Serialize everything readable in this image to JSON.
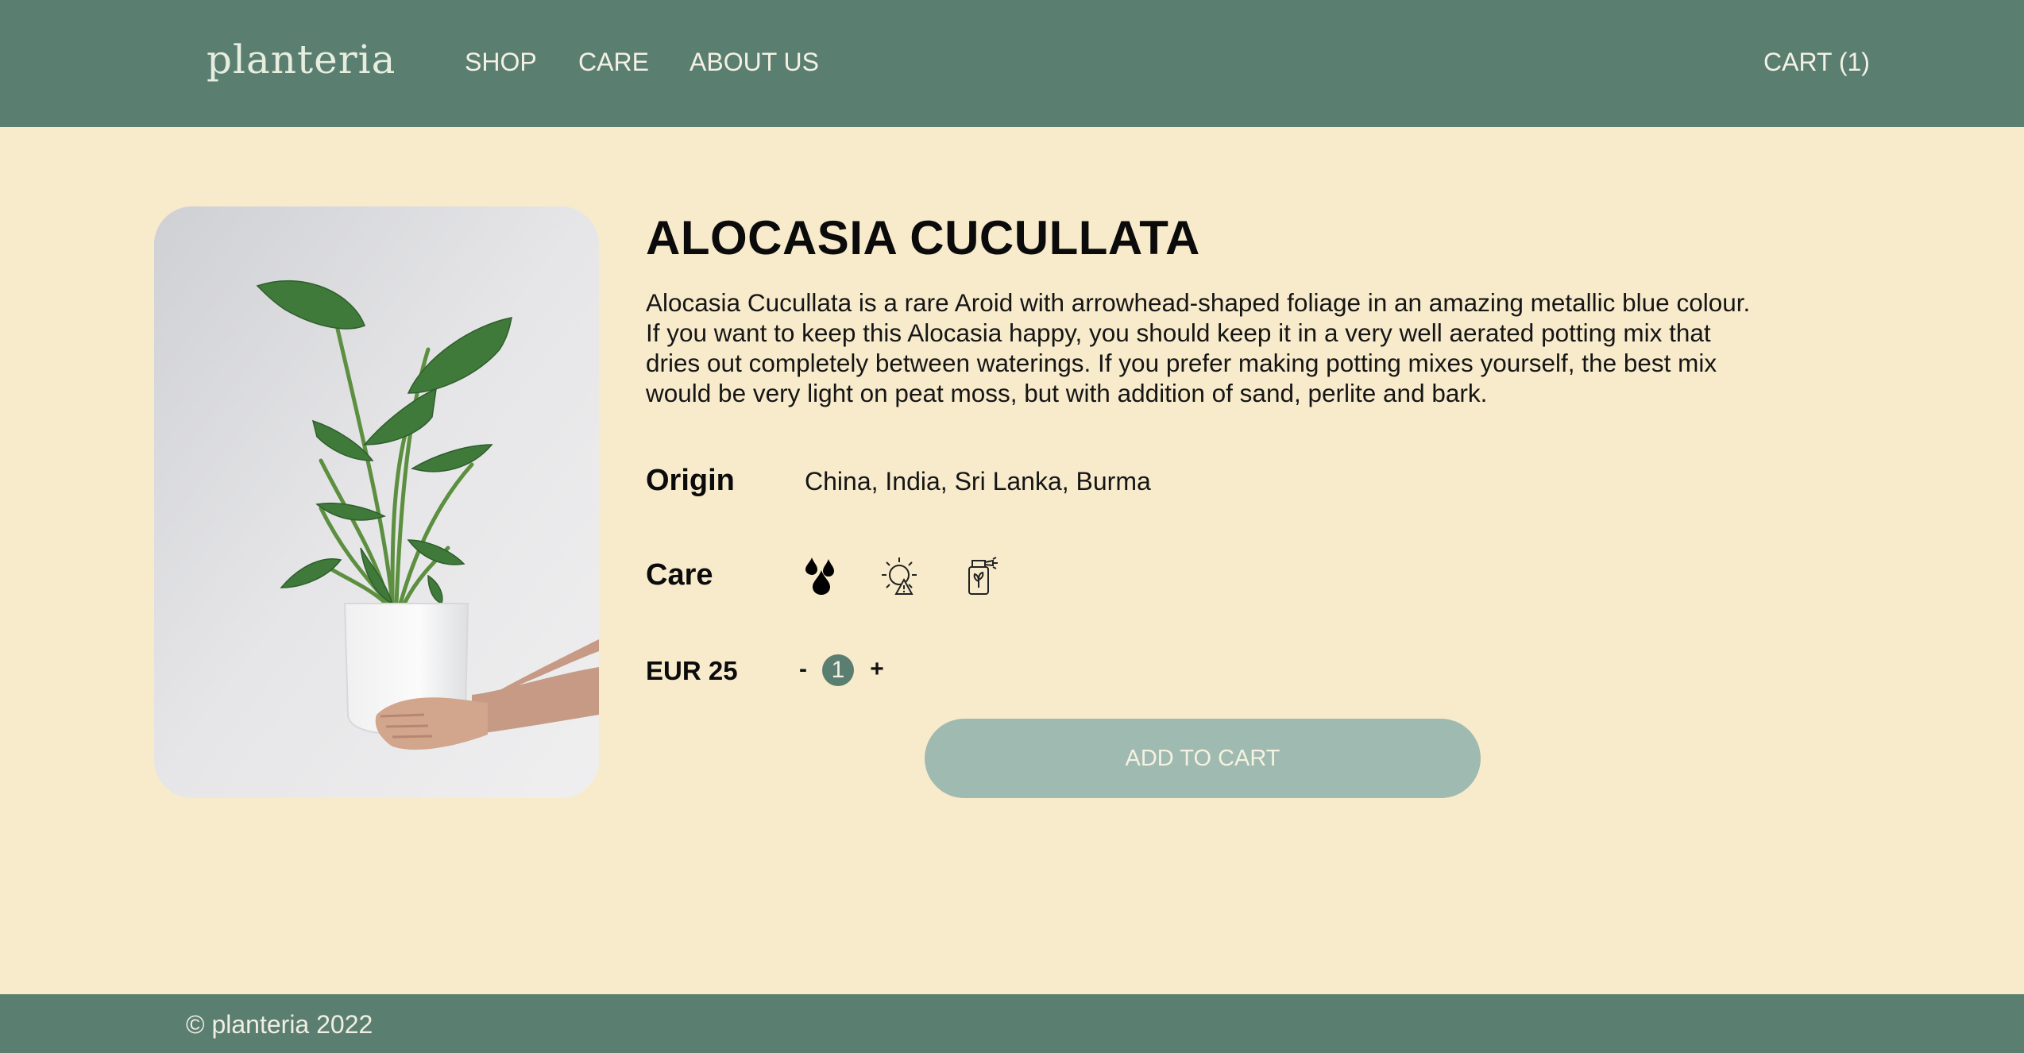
{
  "header": {
    "logo": "planteria",
    "nav": [
      "SHOP",
      "CARE",
      "ABOUT US"
    ],
    "cart_label": "CART (1)"
  },
  "product": {
    "title": "ALOCASIA CUCULLATA",
    "description": "Alocasia Cucullata is a rare Aroid with arrowhead-shaped foliage in an amazing metallic blue colour. If you want to keep this Alocasia happy, you should keep it in a very well aerated potting mix that dries out completely between waterings. If you prefer making potting mixes yourself, the best mix would be very light on peat moss, but with addition of sand, perlite and bark.",
    "origin_label": "Origin",
    "origin_value": "China, India, Sri Lanka, Burma",
    "care_label": "Care",
    "care_icons": [
      "water-drops-icon",
      "sun-warning-icon",
      "fertilizer-spray-icon"
    ],
    "price": "EUR 25",
    "quantity": "1",
    "minus": "-",
    "plus": "+",
    "add_to_cart": "ADD TO CART"
  },
  "footer": {
    "copyright": "© planteria 2022"
  },
  "colors": {
    "header_bg": "#5a7f71",
    "page_bg": "#f8ebcc",
    "button_bg": "#9fbab0"
  }
}
